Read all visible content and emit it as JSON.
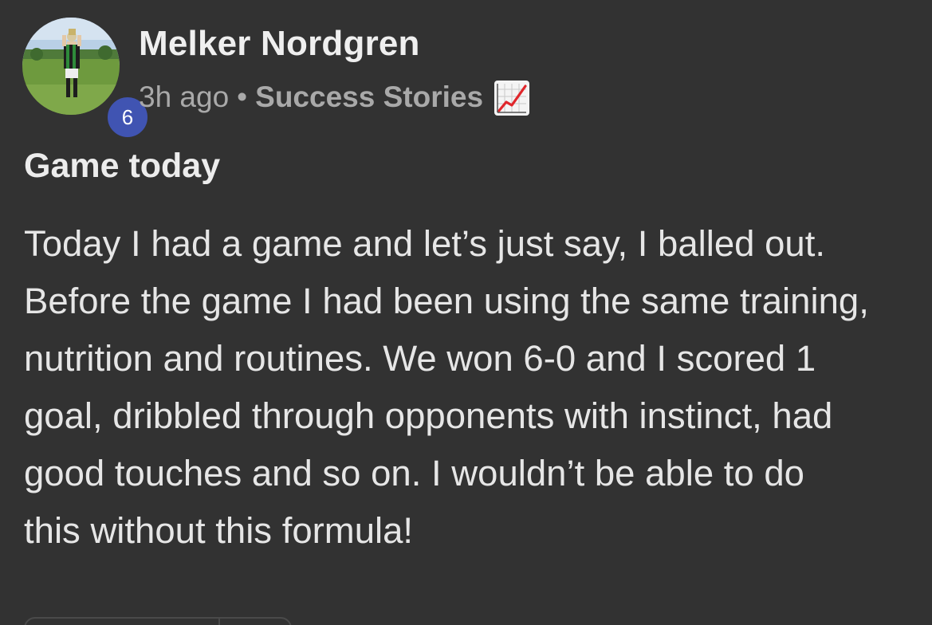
{
  "author": {
    "name": "Melker Nordgren",
    "level": "6"
  },
  "meta": {
    "time": "3h ago",
    "separator": "•",
    "category": "Success Stories",
    "category_icon": "chart-increasing-icon"
  },
  "post": {
    "title": "Game today",
    "body_lines": [
      "Today I had a game and let’s just say, I balled out.",
      "Before the game I had been using the same training,",
      "nutrition and routines. We won 6-0 and I scored 1",
      "goal, dribbled through opponents with instinct, had",
      "good touches and so on. I wouldn’t be able to do",
      "this without this formula!"
    ]
  },
  "colors": {
    "background": "#323232",
    "badge": "#4054b2",
    "text": "#e6e6e6",
    "muted": "#a9a9a9"
  }
}
